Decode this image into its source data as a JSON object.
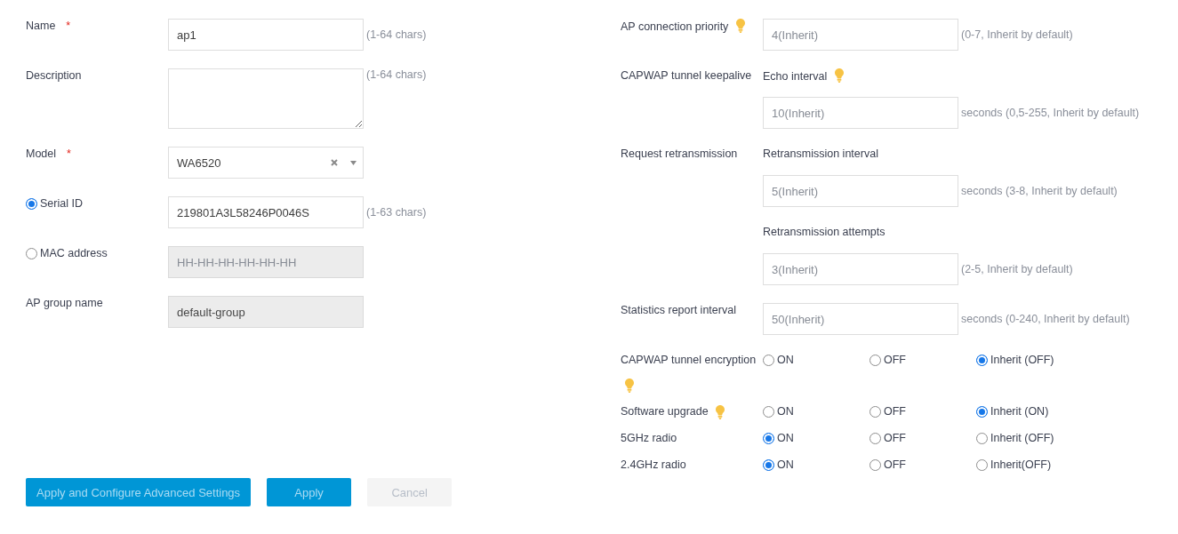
{
  "form": {
    "fields": [
      {
        "kind": "text",
        "label": "Name",
        "required_mark": "*",
        "value": "ap1",
        "hint": "(1-64 chars)",
        "disabled": false
      },
      {
        "kind": "textarea",
        "label": "Description",
        "hint": "(1-64 chars)",
        "disabled": false
      },
      {
        "kind": "select",
        "label": "Model",
        "required_mark": "*",
        "value": "WA6520",
        "disabled": false
      },
      {
        "kind": "text",
        "label": "Serial ID",
        "radio": {
          "selected": true
        },
        "value": "219801A3L58246P0046S",
        "hint": "(1-63 chars)",
        "disabled": false
      },
      {
        "kind": "text",
        "label": "MAC address",
        "radio": {
          "selected": false
        },
        "placeholder": "HH-HH-HH-HH-HH-HH",
        "disabled": true
      },
      {
        "kind": "text",
        "label": "AP group name",
        "value": "default-group",
        "disabled": true
      }
    ],
    "buttons": [
      {
        "label": "Apply and Configure Advanced Settings",
        "disabled": false
      },
      {
        "label": "Apply",
        "disabled": false
      },
      {
        "label": "Cancel",
        "disabled": true
      }
    ]
  },
  "settings": [
    {
      "kind": "input",
      "label": "AP connection priority",
      "tip": true,
      "placeholder": "4(Inherit)",
      "hint": "(0-7, Inherit by default)"
    },
    {
      "kind": "group",
      "label": "CAPWAP tunnel keepalive",
      "tip": false,
      "fields": [
        {
          "label": "Echo interval",
          "tip": true,
          "placeholder": "10(Inherit)",
          "hint": "seconds (0,5-255, Inherit by default)"
        }
      ]
    },
    {
      "kind": "group",
      "label": "Request retransmission",
      "tip": false,
      "fields": [
        {
          "label": "Retransmission interval",
          "tip": false,
          "placeholder": "5(Inherit)",
          "hint": "seconds (3-8, Inherit by default)"
        },
        {
          "label": "Retransmission attempts",
          "tip": false,
          "placeholder": "3(Inherit)",
          "hint": "(2-5, Inherit by default)"
        }
      ]
    },
    {
      "kind": "input",
      "label": "Statistics report interval",
      "tip": false,
      "placeholder": "50(Inherit)",
      "hint": "seconds (0-240, Inherit by default)"
    },
    {
      "kind": "radios",
      "label": "CAPWAP tunnel encryption",
      "tip": true,
      "options": [
        {
          "label": "ON",
          "selected": false
        },
        {
          "label": "OFF",
          "selected": false
        },
        {
          "label": "Inherit (OFF)",
          "selected": true
        }
      ]
    },
    {
      "kind": "radios",
      "label": "Software upgrade",
      "tip": true,
      "options": [
        {
          "label": "ON",
          "selected": false
        },
        {
          "label": "OFF",
          "selected": false
        },
        {
          "label": "Inherit (ON)",
          "selected": true
        }
      ]
    },
    {
      "kind": "radios",
      "label": "5GHz radio",
      "tip": false,
      "options": [
        {
          "label": "ON",
          "selected": true
        },
        {
          "label": "OFF",
          "selected": false
        },
        {
          "label": "Inherit (OFF)",
          "selected": false
        }
      ]
    },
    {
      "kind": "radios",
      "label": "2.4GHz radio",
      "tip": false,
      "options": [
        {
          "label": "ON",
          "selected": true
        },
        {
          "label": "OFF",
          "selected": false
        },
        {
          "label": "Inherit(OFF)",
          "selected": false
        }
      ]
    }
  ]
}
